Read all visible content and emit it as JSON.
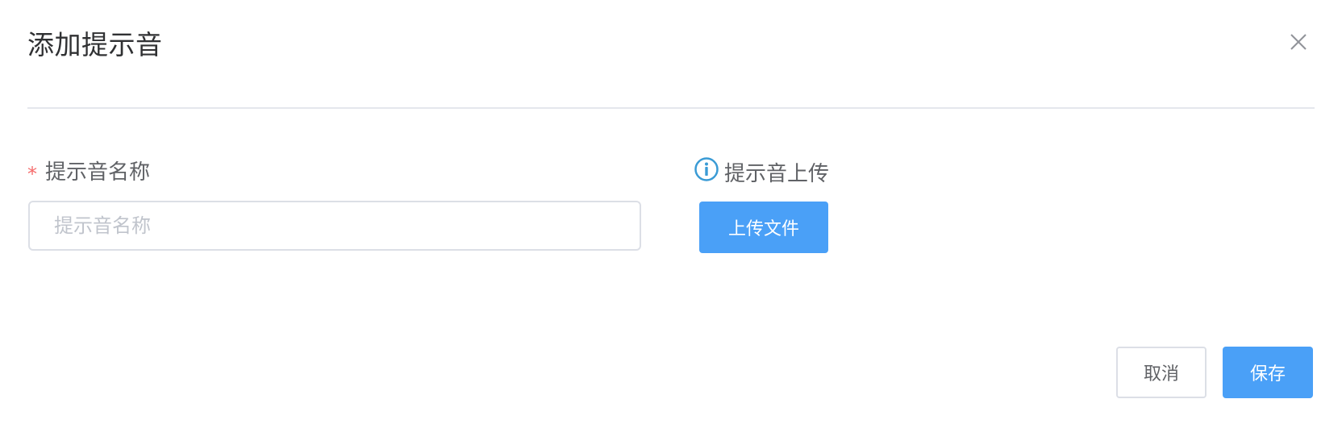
{
  "dialog": {
    "title": "添加提示音",
    "close_icon": "close-icon"
  },
  "form": {
    "name": {
      "required_mark": "*",
      "label": "提示音名称",
      "value": "",
      "placeholder": "提示音名称"
    },
    "upload": {
      "info_icon": "info-icon",
      "label": "提示音上传",
      "button_label": "上传文件"
    }
  },
  "footer": {
    "cancel_label": "取消",
    "save_label": "保存"
  },
  "colors": {
    "primary": "#4aa0f7",
    "required": "#f56c6c",
    "border": "#dcdfe6",
    "info_icon": "#3a9bd5"
  }
}
